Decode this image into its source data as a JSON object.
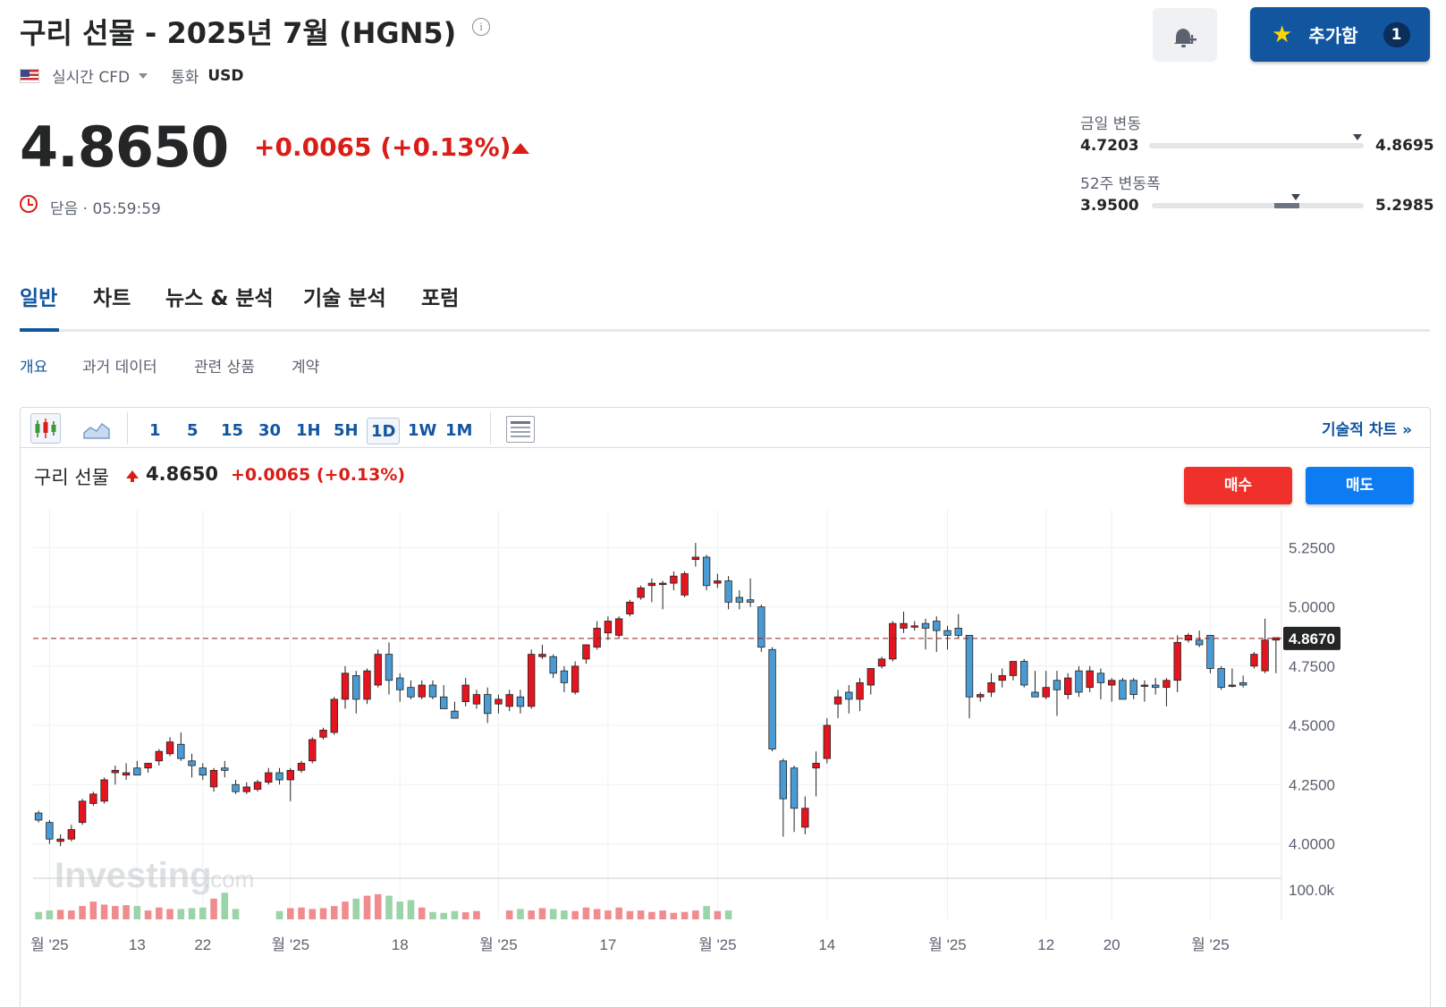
{
  "header": {
    "title": "구리 선물 - 2025년 7월 (HGN5)",
    "info_glyph": "i",
    "market_type": "실시간 CFD",
    "currency_label": "통화",
    "currency": "USD",
    "add_button_label": "추가함",
    "add_button_count": "1"
  },
  "quote": {
    "price": "4.8650",
    "change": "+0.0065 (+0.13%)",
    "status": "닫음 · 05:59:59"
  },
  "ranges": {
    "day_label": "금일 변동",
    "day_low": "4.7203",
    "day_high": "4.8695",
    "day_current": 4.865,
    "week52_label": "52주 변동폭",
    "week52_low": "3.9500",
    "week52_high": "5.2985",
    "week52_current": 4.865
  },
  "tabs": [
    "일반",
    "차트",
    "뉴스 & 분석",
    "기술 분석",
    "포럼"
  ],
  "subtabs": [
    "개요",
    "과거 데이터",
    "관련 상품",
    "계약"
  ],
  "toolbar": {
    "timeframes": [
      "1",
      "5",
      "15",
      "30",
      "1H",
      "5H",
      "1D",
      "1W",
      "1M"
    ],
    "selected": "1D",
    "technical_chart_link": "기술적 차트 »"
  },
  "chart_legend": {
    "name": "구리 선물",
    "price": "4.8650",
    "change": "+0.0065",
    "change_pct": "(+0.13%)"
  },
  "trade": {
    "buy_label": "매수",
    "sell_label": "매도"
  },
  "colors": {
    "up": "#e4151f",
    "down": "#4a9bd4",
    "vol_up": "#f08c8e",
    "vol_down": "#9ad4a8",
    "accent": "#1256a0"
  },
  "watermark": {
    "brand": "Investing",
    "suffix": ".com"
  },
  "chart_data": {
    "type": "candlestick",
    "title": "구리 선물",
    "y_ticks": [
      "5.2500",
      "5.0000",
      "4.7500",
      "4.5000",
      "4.2500",
      "4.0000"
    ],
    "y_tick_values": [
      5.25,
      5.0,
      4.75,
      4.5,
      4.25,
      4.0
    ],
    "ylim": [
      3.9,
      5.41
    ],
    "current_price_label": "4.8670",
    "current_price": 4.867,
    "volume_tick": "100.0k",
    "volume_tick_value": 100,
    "volume_max": 130,
    "x_tick_labels": [
      "월 '25",
      "13",
      "22",
      "월 '25",
      "18",
      "월 '25",
      "17",
      "월 '25",
      "14",
      "월 '25",
      "12",
      "20",
      "월 '25"
    ],
    "x_tick_index": [
      1,
      9,
      15,
      23,
      33,
      42,
      52,
      62,
      72,
      83,
      92,
      98,
      107
    ],
    "candles": [
      {
        "o": 4.13,
        "h": 4.14,
        "l": 4.09,
        "c": 4.1
      },
      {
        "o": 4.09,
        "h": 4.1,
        "l": 4.0,
        "c": 4.02
      },
      {
        "o": 4.01,
        "h": 4.04,
        "l": 3.99,
        "c": 4.02
      },
      {
        "o": 4.02,
        "h": 4.08,
        "l": 4.01,
        "c": 4.06
      },
      {
        "o": 4.09,
        "h": 4.19,
        "l": 4.08,
        "c": 4.18
      },
      {
        "o": 4.17,
        "h": 4.22,
        "l": 4.16,
        "c": 4.21
      },
      {
        "o": 4.18,
        "h": 4.28,
        "l": 4.17,
        "c": 4.27
      },
      {
        "o": 4.3,
        "h": 4.33,
        "l": 4.25,
        "c": 4.31
      },
      {
        "o": 4.29,
        "h": 4.34,
        "l": 4.27,
        "c": 4.3
      },
      {
        "o": 4.32,
        "h": 4.35,
        "l": 4.29,
        "c": 4.29
      },
      {
        "o": 4.32,
        "h": 4.34,
        "l": 4.3,
        "c": 4.34
      },
      {
        "o": 4.35,
        "h": 4.4,
        "l": 4.33,
        "c": 4.39
      },
      {
        "o": 4.38,
        "h": 4.45,
        "l": 4.37,
        "c": 4.43
      },
      {
        "o": 4.42,
        "h": 4.47,
        "l": 4.35,
        "c": 4.36
      },
      {
        "o": 4.35,
        "h": 4.38,
        "l": 4.28,
        "c": 4.33
      },
      {
        "o": 4.32,
        "h": 4.34,
        "l": 4.27,
        "c": 4.29
      },
      {
        "o": 4.24,
        "h": 4.32,
        "l": 4.22,
        "c": 4.31
      },
      {
        "o": 4.32,
        "h": 4.35,
        "l": 4.28,
        "c": 4.31
      },
      {
        "o": 4.25,
        "h": 4.27,
        "l": 4.21,
        "c": 4.22
      },
      {
        "o": 4.22,
        "h": 4.26,
        "l": 4.21,
        "c": 4.24
      },
      {
        "o": 4.23,
        "h": 4.27,
        "l": 4.22,
        "c": 4.26
      },
      {
        "o": 4.26,
        "h": 4.32,
        "l": 4.25,
        "c": 4.3
      },
      {
        "o": 4.3,
        "h": 4.32,
        "l": 4.25,
        "c": 4.27
      },
      {
        "o": 4.27,
        "h": 4.32,
        "l": 4.18,
        "c": 4.31
      },
      {
        "o": 4.31,
        "h": 4.35,
        "l": 4.3,
        "c": 4.34
      },
      {
        "o": 4.35,
        "h": 4.45,
        "l": 4.34,
        "c": 4.44
      },
      {
        "o": 4.45,
        "h": 4.49,
        "l": 4.44,
        "c": 4.48
      },
      {
        "o": 4.47,
        "h": 4.62,
        "l": 4.46,
        "c": 4.61
      },
      {
        "o": 4.61,
        "h": 4.75,
        "l": 4.57,
        "c": 4.72
      },
      {
        "o": 4.71,
        "h": 4.73,
        "l": 4.55,
        "c": 4.61
      },
      {
        "o": 4.61,
        "h": 4.74,
        "l": 4.59,
        "c": 4.73
      },
      {
        "o": 4.67,
        "h": 4.82,
        "l": 4.66,
        "c": 4.8
      },
      {
        "o": 4.8,
        "h": 4.85,
        "l": 4.63,
        "c": 4.69
      },
      {
        "o": 4.7,
        "h": 4.72,
        "l": 4.6,
        "c": 4.65
      },
      {
        "o": 4.66,
        "h": 4.69,
        "l": 4.61,
        "c": 4.62
      },
      {
        "o": 4.62,
        "h": 4.69,
        "l": 4.61,
        "c": 4.67
      },
      {
        "o": 4.67,
        "h": 4.69,
        "l": 4.61,
        "c": 4.62
      },
      {
        "o": 4.62,
        "h": 4.67,
        "l": 4.57,
        "c": 4.57
      },
      {
        "o": 4.56,
        "h": 4.6,
        "l": 4.53,
        "c": 4.53
      },
      {
        "o": 4.6,
        "h": 4.7,
        "l": 4.58,
        "c": 4.67
      },
      {
        "o": 4.59,
        "h": 4.65,
        "l": 4.57,
        "c": 4.63
      },
      {
        "o": 4.63,
        "h": 4.66,
        "l": 4.51,
        "c": 4.55
      },
      {
        "o": 4.59,
        "h": 4.63,
        "l": 4.55,
        "c": 4.61
      },
      {
        "o": 4.58,
        "h": 4.65,
        "l": 4.56,
        "c": 4.63
      },
      {
        "o": 4.62,
        "h": 4.65,
        "l": 4.55,
        "c": 4.58
      },
      {
        "o": 4.58,
        "h": 4.82,
        "l": 4.57,
        "c": 4.8
      },
      {
        "o": 4.79,
        "h": 4.84,
        "l": 4.78,
        "c": 4.8
      },
      {
        "o": 4.79,
        "h": 4.8,
        "l": 4.7,
        "c": 4.72
      },
      {
        "o": 4.73,
        "h": 4.75,
        "l": 4.64,
        "c": 4.68
      },
      {
        "o": 4.64,
        "h": 4.77,
        "l": 4.63,
        "c": 4.75
      },
      {
        "o": 4.78,
        "h": 4.84,
        "l": 4.76,
        "c": 4.84
      },
      {
        "o": 4.83,
        "h": 4.94,
        "l": 4.82,
        "c": 4.91
      },
      {
        "o": 4.89,
        "h": 4.96,
        "l": 4.86,
        "c": 4.94
      },
      {
        "o": 4.88,
        "h": 4.96,
        "l": 4.87,
        "c": 4.95
      },
      {
        "o": 4.97,
        "h": 5.03,
        "l": 4.96,
        "c": 5.02
      },
      {
        "o": 5.04,
        "h": 5.09,
        "l": 5.03,
        "c": 5.08
      },
      {
        "o": 5.09,
        "h": 5.12,
        "l": 5.02,
        "c": 5.1
      },
      {
        "o": 5.1,
        "h": 5.11,
        "l": 4.99,
        "c": 5.1
      },
      {
        "o": 5.1,
        "h": 5.15,
        "l": 5.07,
        "c": 5.13
      },
      {
        "o": 5.05,
        "h": 5.15,
        "l": 5.04,
        "c": 5.14
      },
      {
        "o": 5.2,
        "h": 5.27,
        "l": 5.17,
        "c": 5.21
      },
      {
        "o": 5.21,
        "h": 5.22,
        "l": 5.07,
        "c": 5.09
      },
      {
        "o": 5.1,
        "h": 5.14,
        "l": 5.08,
        "c": 5.11
      },
      {
        "o": 5.11,
        "h": 5.13,
        "l": 4.99,
        "c": 5.02
      },
      {
        "o": 5.04,
        "h": 5.07,
        "l": 4.99,
        "c": 5.02
      },
      {
        "o": 5.03,
        "h": 5.12,
        "l": 5.0,
        "c": 5.02
      },
      {
        "o": 5.0,
        "h": 5.01,
        "l": 4.81,
        "c": 4.83
      },
      {
        "o": 4.82,
        "h": 4.83,
        "l": 4.39,
        "c": 4.4
      },
      {
        "o": 4.35,
        "h": 4.36,
        "l": 4.03,
        "c": 4.19
      },
      {
        "o": 4.32,
        "h": 4.33,
        "l": 4.05,
        "c": 4.15
      },
      {
        "o": 4.07,
        "h": 4.2,
        "l": 4.04,
        "c": 4.15
      },
      {
        "o": 4.32,
        "h": 4.39,
        "l": 4.2,
        "c": 4.34
      },
      {
        "o": 4.36,
        "h": 4.53,
        "l": 4.34,
        "c": 4.5
      },
      {
        "o": 4.59,
        "h": 4.65,
        "l": 4.53,
        "c": 4.62
      },
      {
        "o": 4.64,
        "h": 4.67,
        "l": 4.55,
        "c": 4.61
      },
      {
        "o": 4.61,
        "h": 4.7,
        "l": 4.56,
        "c": 4.68
      },
      {
        "o": 4.67,
        "h": 4.74,
        "l": 4.63,
        "c": 4.74
      },
      {
        "o": 4.75,
        "h": 4.79,
        "l": 4.74,
        "c": 4.78
      },
      {
        "o": 4.78,
        "h": 4.94,
        "l": 4.77,
        "c": 4.93
      },
      {
        "o": 4.91,
        "h": 4.98,
        "l": 4.89,
        "c": 4.93
      },
      {
        "o": 4.92,
        "h": 4.94,
        "l": 4.9,
        "c": 4.92
      },
      {
        "o": 4.93,
        "h": 4.95,
        "l": 4.82,
        "c": 4.91
      },
      {
        "o": 4.94,
        "h": 4.96,
        "l": 4.81,
        "c": 4.9
      },
      {
        "o": 4.9,
        "h": 4.92,
        "l": 4.82,
        "c": 4.88
      },
      {
        "o": 4.91,
        "h": 4.97,
        "l": 4.87,
        "c": 4.88
      },
      {
        "o": 4.88,
        "h": 4.88,
        "l": 4.53,
        "c": 4.62
      },
      {
        "o": 4.62,
        "h": 4.64,
        "l": 4.6,
        "c": 4.63
      },
      {
        "o": 4.64,
        "h": 4.72,
        "l": 4.62,
        "c": 4.68
      },
      {
        "o": 4.69,
        "h": 4.74,
        "l": 4.66,
        "c": 4.71
      },
      {
        "o": 4.71,
        "h": 4.76,
        "l": 4.69,
        "c": 4.77
      },
      {
        "o": 4.77,
        "h": 4.78,
        "l": 4.66,
        "c": 4.67
      },
      {
        "o": 4.64,
        "h": 4.73,
        "l": 4.62,
        "c": 4.62
      },
      {
        "o": 4.62,
        "h": 4.73,
        "l": 4.61,
        "c": 4.66
      },
      {
        "o": 4.69,
        "h": 4.73,
        "l": 4.54,
        "c": 4.65
      },
      {
        "o": 4.63,
        "h": 4.72,
        "l": 4.61,
        "c": 4.7
      },
      {
        "o": 4.73,
        "h": 4.75,
        "l": 4.62,
        "c": 4.64
      },
      {
        "o": 4.66,
        "h": 4.75,
        "l": 4.64,
        "c": 4.73
      },
      {
        "o": 4.72,
        "h": 4.74,
        "l": 4.61,
        "c": 4.68
      },
      {
        "o": 4.67,
        "h": 4.7,
        "l": 4.6,
        "c": 4.69
      },
      {
        "o": 4.69,
        "h": 4.7,
        "l": 4.61,
        "c": 4.61
      },
      {
        "o": 4.69,
        "h": 4.7,
        "l": 4.61,
        "c": 4.63
      },
      {
        "o": 4.67,
        "h": 4.69,
        "l": 4.6,
        "c": 4.67
      },
      {
        "o": 4.67,
        "h": 4.7,
        "l": 4.63,
        "c": 4.66
      },
      {
        "o": 4.66,
        "h": 4.7,
        "l": 4.58,
        "c": 4.69
      },
      {
        "o": 4.69,
        "h": 4.88,
        "l": 4.64,
        "c": 4.85
      },
      {
        "o": 4.86,
        "h": 4.89,
        "l": 4.85,
        "c": 4.88
      },
      {
        "o": 4.86,
        "h": 4.9,
        "l": 4.83,
        "c": 4.84
      },
      {
        "o": 4.88,
        "h": 4.88,
        "l": 4.72,
        "c": 4.74
      },
      {
        "o": 4.74,
        "h": 4.75,
        "l": 4.65,
        "c": 4.66
      },
      {
        "o": 4.67,
        "h": 4.74,
        "l": 4.66,
        "c": 4.67
      },
      {
        "o": 4.68,
        "h": 4.71,
        "l": 4.66,
        "c": 4.67
      },
      {
        "o": 4.75,
        "h": 4.81,
        "l": 4.74,
        "c": 4.8
      },
      {
        "o": 4.73,
        "h": 4.95,
        "l": 4.72,
        "c": 4.86
      },
      {
        "o": 4.86,
        "h": 4.87,
        "l": 4.72,
        "c": 4.87
      }
    ],
    "volumes": [
      25,
      30,
      32,
      30,
      45,
      60,
      50,
      45,
      48,
      45,
      30,
      40,
      35,
      35,
      38,
      40,
      70,
      90,
      35,
      0,
      0,
      0,
      28,
      38,
      40,
      35,
      38,
      45,
      60,
      70,
      80,
      85,
      80,
      60,
      65,
      40,
      25,
      22,
      28,
      24,
      28,
      0,
      0,
      30,
      35,
      30,
      38,
      35,
      30,
      28,
      40,
      35,
      30,
      40,
      28,
      30,
      25,
      30,
      22,
      25,
      30,
      45,
      28,
      30,
      0,
      0,
      0,
      0,
      0,
      0,
      0,
      0,
      0,
      0,
      0,
      0,
      0,
      0,
      0,
      0,
      0,
      0,
      0,
      0,
      0,
      0,
      0,
      0,
      0,
      0,
      0,
      0,
      0,
      0,
      0,
      0,
      0,
      0,
      0,
      0,
      0,
      0,
      0,
      0,
      0,
      0,
      0,
      0,
      0,
      0,
      0,
      0,
      0,
      0,
      0,
      0
    ]
  }
}
